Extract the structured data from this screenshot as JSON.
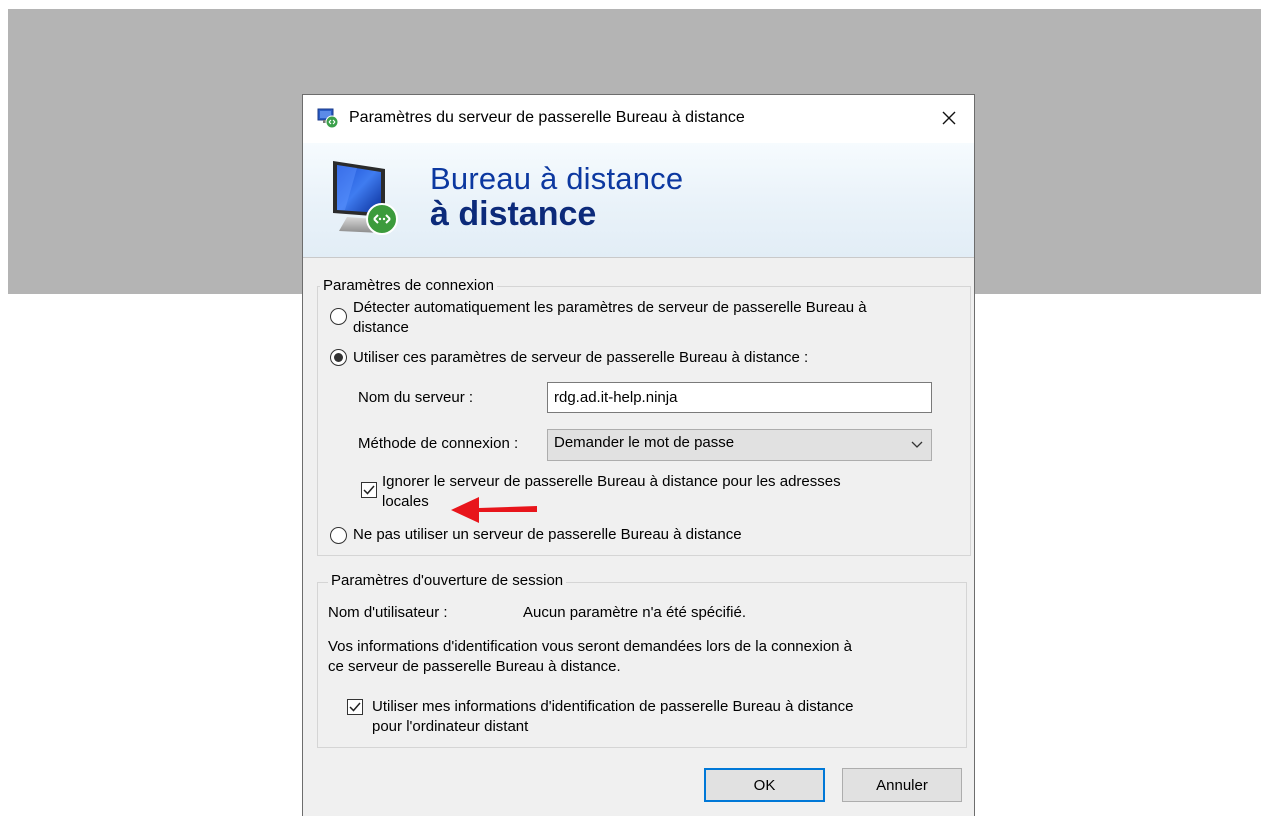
{
  "window": {
    "title": "Paramètres du serveur de passerelle Bureau à distance",
    "close_glyph": "✕"
  },
  "banner": {
    "line1": "Bureau à distance",
    "line2": "à distance"
  },
  "connection": {
    "legend": "Paramètres de connexion",
    "auto_detect_line1": "Détecter automatiquement les paramètres de serveur de passerelle Bureau à",
    "auto_detect_line2": "distance",
    "auto_detect_selected": false,
    "use_settings_label": "Utiliser ces paramètres de serveur de passerelle Bureau à distance :",
    "use_settings_selected": true,
    "server_name_label": "Nom du serveur :",
    "server_name_value": "rdg.ad.it-help.ninja",
    "method_label": "Méthode de connexion :",
    "method_value": "Demander le mot de passe",
    "bypass_local_line1": "Ignorer le serveur de passerelle Bureau à distance pour les adresses",
    "bypass_local_line2": "locales",
    "bypass_local_checked": true,
    "no_gateway_label": "Ne pas utiliser un serveur de passerelle Bureau à distance",
    "no_gateway_selected": false
  },
  "logon": {
    "legend": "Paramètres d'ouverture de session",
    "username_label": "Nom d'utilisateur :",
    "username_value": "Aucun paramètre n'a été spécifié.",
    "info_line1": "Vos informations d'identification vous seront demandées lors de la connexion à",
    "info_line2": "ce serveur de passerelle Bureau à distance.",
    "use_credentials_line1": "Utiliser mes informations d'identification de passerelle Bureau à distance",
    "use_credentials_line2": "pour l'ordinateur distant",
    "use_credentials_checked": true
  },
  "buttons": {
    "ok": "OK",
    "cancel": "Annuler"
  },
  "colors": {
    "annotation_arrow": "#e8151b",
    "banner_title": "#0c38a0",
    "default_button_border": "#0078d7"
  },
  "icons": {
    "title": "remote-desktop-icon",
    "banner": "monitor-remote-icon",
    "close": "close-icon",
    "combo": "chevron-down-icon",
    "annotation": "red-arrow-icon"
  }
}
